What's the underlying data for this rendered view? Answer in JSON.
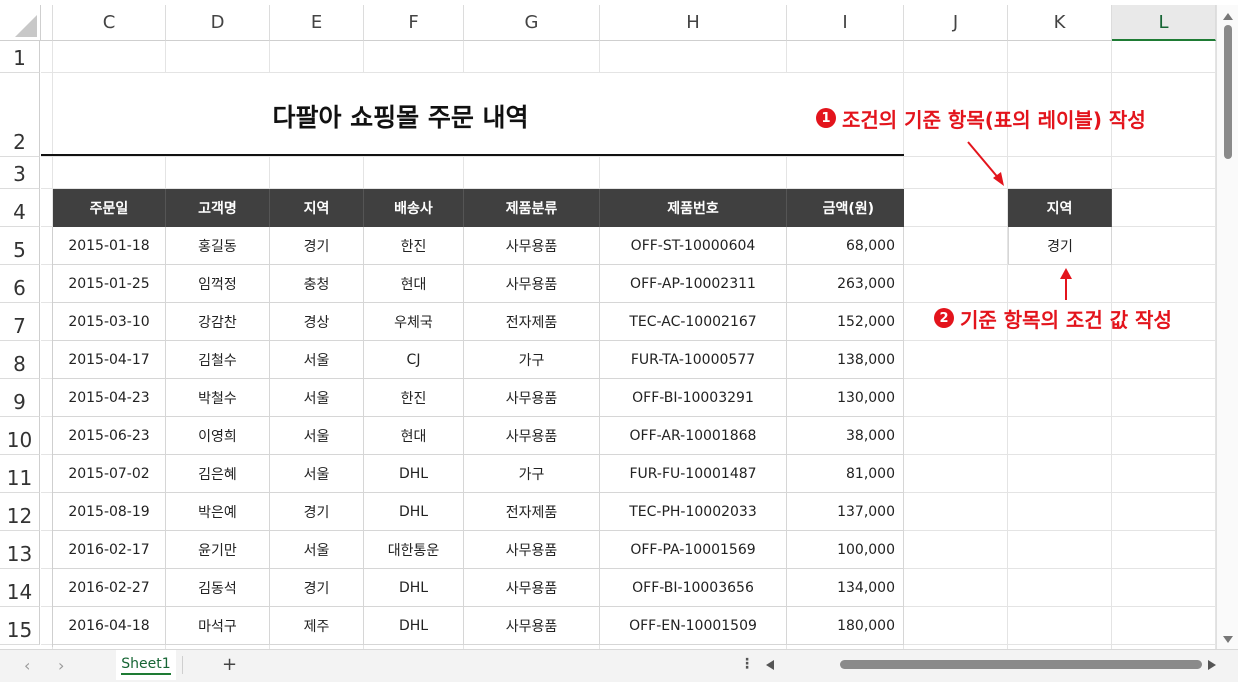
{
  "columns": [
    "C",
    "D",
    "E",
    "F",
    "G",
    "H",
    "I",
    "J",
    "K",
    "L"
  ],
  "rows": [
    "1",
    "2",
    "3",
    "4",
    "5",
    "6",
    "7",
    "8",
    "9",
    "10",
    "11",
    "12",
    "13",
    "14",
    "15"
  ],
  "title": "다팔아 쇼핑몰 주문 내역",
  "table": {
    "headers": [
      "주문일",
      "고객명",
      "지역",
      "배송사",
      "제품분류",
      "제품번호",
      "금액(원)"
    ],
    "rows": [
      [
        "2015-01-18",
        "홍길동",
        "경기",
        "한진",
        "사무용품",
        "OFF-ST-10000604",
        "68,000"
      ],
      [
        "2015-01-25",
        "임꺽정",
        "충청",
        "현대",
        "사무용품",
        "OFF-AP-10002311",
        "263,000"
      ],
      [
        "2015-03-10",
        "강감찬",
        "경상",
        "우체국",
        "전자제품",
        "TEC-AC-10002167",
        "152,000"
      ],
      [
        "2015-04-17",
        "김철수",
        "서울",
        "CJ",
        "가구",
        "FUR-TA-10000577",
        "138,000"
      ],
      [
        "2015-04-23",
        "박철수",
        "서울",
        "한진",
        "사무용품",
        "OFF-BI-10003291",
        "130,000"
      ],
      [
        "2015-06-23",
        "이영희",
        "서울",
        "현대",
        "사무용품",
        "OFF-AR-10001868",
        "38,000"
      ],
      [
        "2015-07-02",
        "김은혜",
        "서울",
        "DHL",
        "가구",
        "FUR-FU-10001487",
        "81,000"
      ],
      [
        "2015-08-19",
        "박은예",
        "경기",
        "DHL",
        "전자제품",
        "TEC-PH-10002033",
        "137,000"
      ],
      [
        "2016-02-17",
        "윤기만",
        "서울",
        "대한통운",
        "사무용품",
        "OFF-PA-10001569",
        "100,000"
      ],
      [
        "2016-02-27",
        "김동석",
        "경기",
        "DHL",
        "사무용품",
        "OFF-BI-10003656",
        "134,000"
      ],
      [
        "2016-04-18",
        "마석구",
        "제주",
        "DHL",
        "사무용품",
        "OFF-EN-10001509",
        "180,000"
      ]
    ]
  },
  "criteria": {
    "header": "지역",
    "value": "경기"
  },
  "annotations": {
    "one_badge": "1",
    "one_text": "조건의 기준 항목(표의 레이블) 작성",
    "two_badge": "2",
    "two_text": "기준 항목의 조건 값 작성"
  },
  "sheet_tab": "Sheet1",
  "add_sheet": "+",
  "colors": {
    "annotation": "#e3141c",
    "header_fill": "#404040",
    "selected_col": "#1e7b34"
  }
}
